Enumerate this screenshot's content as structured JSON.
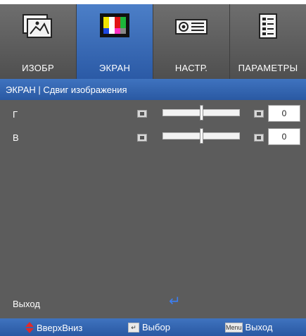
{
  "tabs": [
    {
      "label": "ИЗОБР",
      "icon": "image-icon",
      "active": false
    },
    {
      "label": "ЭКРАН",
      "icon": "screen-color-bars-icon",
      "active": true
    },
    {
      "label": "НАСТР.",
      "icon": "projector-setup-icon",
      "active": false
    },
    {
      "label": "ПАРАМЕТРЫ",
      "icon": "options-document-icon",
      "active": false
    }
  ],
  "breadcrumb": "ЭКРАН | Сдвиг изображения",
  "rows": [
    {
      "label": "Г",
      "value": "0",
      "level": 0.5
    },
    {
      "label": "В",
      "value": "0",
      "level": 0.5
    }
  ],
  "exit": {
    "label": "Выход"
  },
  "footer": {
    "nav_label": "ВверхВниз",
    "select_label": "Выбор",
    "menu_key": "Menu",
    "exit_label": "Выход"
  },
  "colors": {
    "accent": "#2f63b0",
    "panel": "#5c5c5c"
  }
}
